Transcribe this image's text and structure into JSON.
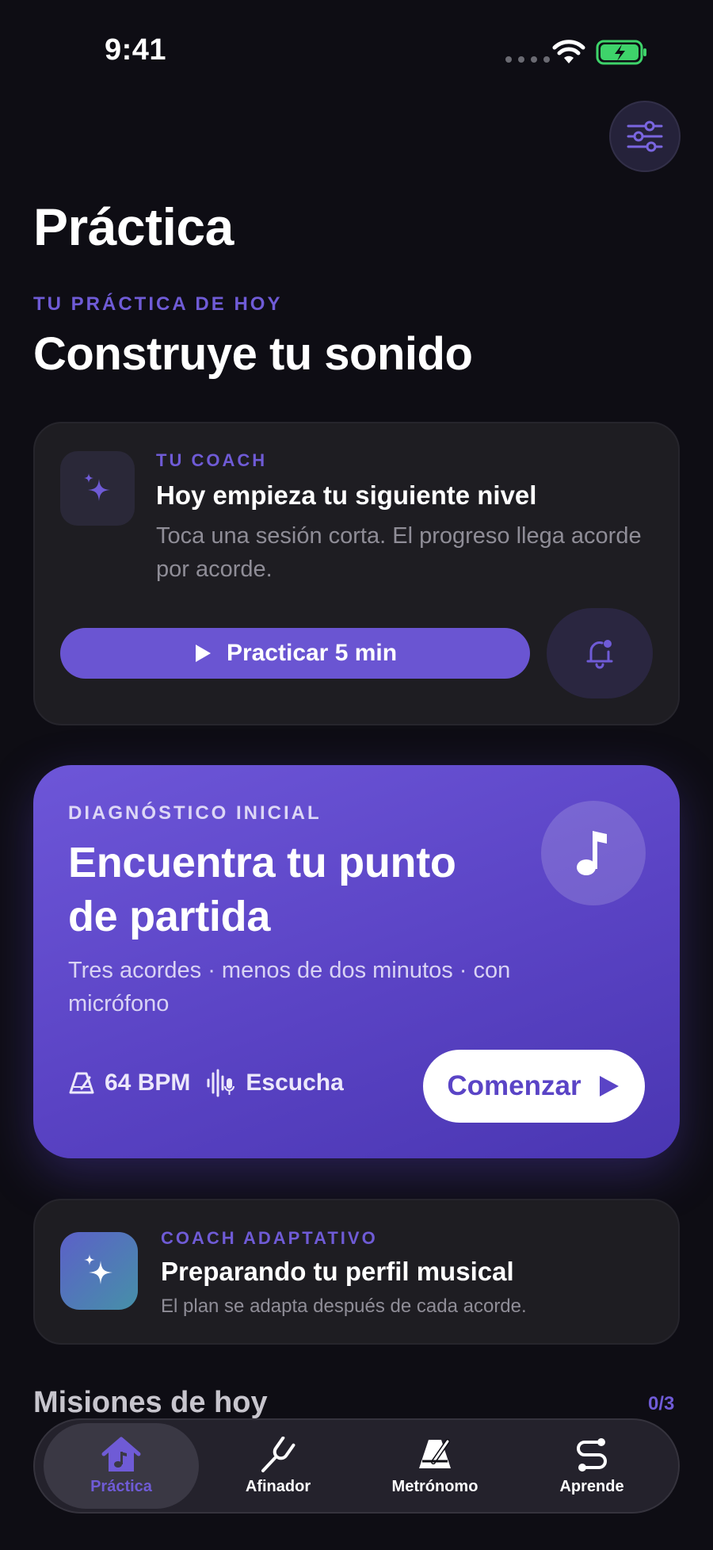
{
  "status_bar": {
    "time": "9:41"
  },
  "header": {
    "title": "Práctica"
  },
  "hero": {
    "eyebrow": "TU PRÁCTICA DE HOY",
    "heading": "Construye tu sonido"
  },
  "coach_card": {
    "eyebrow": "TU COACH",
    "title": "Hoy empieza tu siguiente nivel",
    "description": "Toca una sesión corta. El progreso llega acorde por acorde.",
    "practice_button": "Practicar 5 min"
  },
  "diagnostic_card": {
    "eyebrow": "DIAGNÓSTICO INICIAL",
    "title": "Encuentra tu punto de partida",
    "description": "Tres acordes · menos de dos minutos · con micrófono",
    "tempo": "64 BPM",
    "mode": "Escucha",
    "start_button": "Comenzar"
  },
  "adaptive_card": {
    "eyebrow": "COACH ADAPTATIVO",
    "title": "Preparando tu perfil musical",
    "description": "El plan se adapta después de cada acorde."
  },
  "missions": {
    "title": "Misiones de hoy",
    "count": "0/3"
  },
  "tabbar": {
    "tabs": [
      {
        "label": "Práctica",
        "icon": "home-music-icon",
        "active": true
      },
      {
        "label": "Afinador",
        "icon": "tuning-fork-icon",
        "active": false
      },
      {
        "label": "Metrónomo",
        "icon": "metronome-icon",
        "active": false
      },
      {
        "label": "Aprende",
        "icon": "path-icon",
        "active": false
      }
    ]
  },
  "colors": {
    "background": "#0e0d14",
    "accent": "#6f5bd6",
    "card": "#1e1d22",
    "diagnostic_gradient_start": "#6d56d8",
    "diagnostic_gradient_end": "#4a36b2"
  }
}
